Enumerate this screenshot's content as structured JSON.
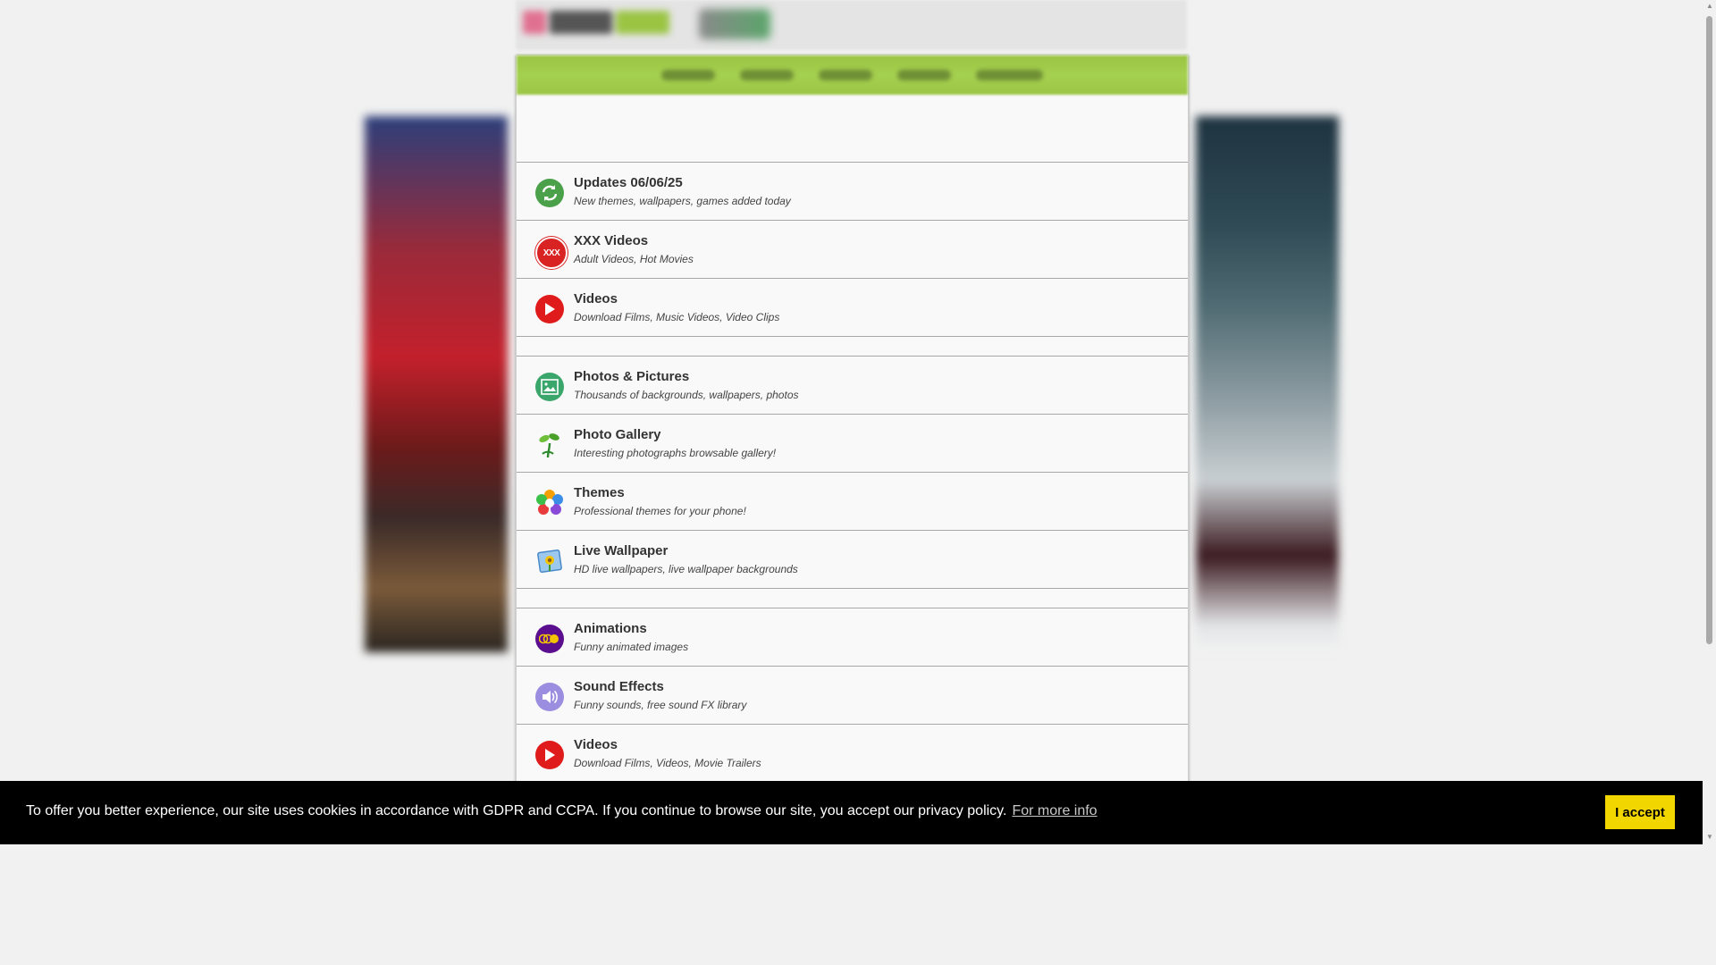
{
  "page": {
    "bg": "#f1f1f1"
  },
  "list": [
    {
      "title": "Updates 06/06/25",
      "subtitle": "New themes, wallpapers, games added today",
      "icon": "refresh-icon",
      "color": "#4aa14a"
    },
    {
      "title": "XXX Videos",
      "subtitle": "Adult Videos, Hot Movies",
      "icon": "xxx-icon",
      "color": "#d92222"
    },
    {
      "title": "Videos",
      "subtitle": "Download Films, Music Videos, Video Clips",
      "icon": "play-icon",
      "color": "#e01b1b"
    },
    {
      "spacer": true
    },
    {
      "title": "Photos & Pictures",
      "subtitle": "Thousands of backgrounds, wallpapers, photos",
      "icon": "picture-icon",
      "color": "#3aa66b"
    },
    {
      "title": "Photo Gallery",
      "subtitle": "Interesting photographs browsable gallery!",
      "icon": "plant-icon",
      "color": "#3d9b3d"
    },
    {
      "title": "Themes",
      "subtitle": "Professional themes for your phone!",
      "icon": "flower-icon",
      "color": "#f0b000"
    },
    {
      "title": "Live Wallpaper",
      "subtitle": "HD live wallpapers, live wallpaper backgrounds",
      "icon": "sunflower-picture-icon",
      "color": "#5a9ad8"
    },
    {
      "spacer": true
    },
    {
      "title": "Animations",
      "subtitle": "Funny animated images",
      "icon": "animation-icon",
      "color": "#5b0f8f"
    },
    {
      "title": "Sound Effects",
      "subtitle": "Funny sounds, free sound FX library",
      "icon": "speaker-icon",
      "color": "#9b8ee0"
    },
    {
      "title": "Videos",
      "subtitle": "Download Films, Videos, Movie Trailers",
      "icon": "play-icon",
      "color": "#e01b1b"
    }
  ],
  "cookie": {
    "text": "To offer you better experience, our site uses cookies in accordance with GDPR and CCPA. If you continue to browse our site, you accept our privacy policy.",
    "link": "For more info",
    "accept": "I accept",
    "accept_color": "#f1d600"
  }
}
